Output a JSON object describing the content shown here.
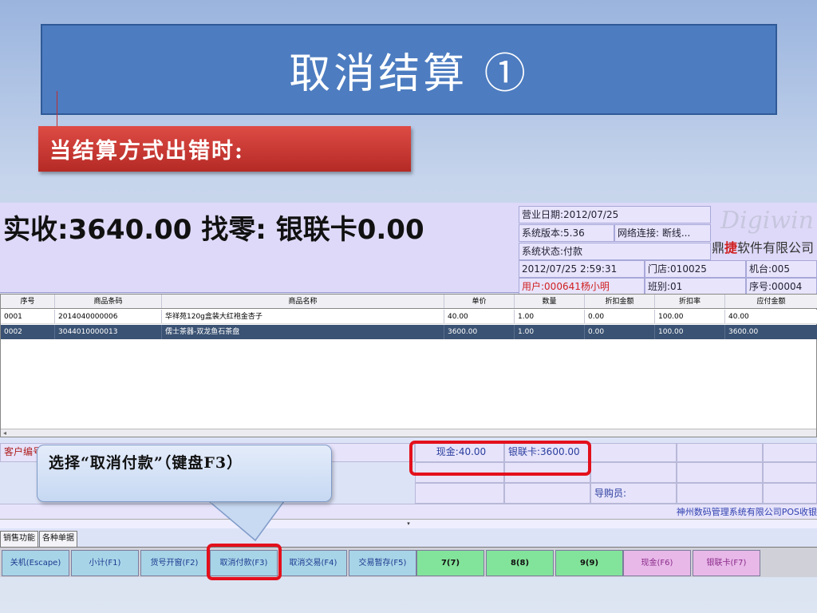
{
  "slide": {
    "title": "取消结算 ①",
    "subtitle": "当结算方式出错时:",
    "callout": "选择“取消付款”（键盘F3）"
  },
  "pos": {
    "amount_line": "实收:3640.00 找零: 银联卡0.00",
    "info": {
      "business_date": "营业日期:2012/07/25",
      "version": "系统版本:5.36",
      "network": "网络连接: 断线...",
      "status": "系统状态:付款",
      "datetime": "2012/07/25 2:59:31",
      "store": "门店:010025",
      "machine": "机台:005",
      "user": "用户:000641杨小明",
      "shift": "班别:01",
      "sequence": "序号:00004"
    },
    "logo": {
      "script": "Digiwin",
      "name_prefix": "鼎",
      "name_highlight": "捷",
      "name_suffix": "软件有限公司"
    },
    "columns": [
      "序号",
      "商品条码",
      "商品名称",
      "单价",
      "数量",
      "折扣金额",
      "折扣率",
      "应付金额"
    ],
    "rows": [
      [
        "0001",
        "2014040000006",
        "华祥苑120g盒装大红袍金杏子",
        "40.00",
        "1.00",
        "0.00",
        "100.00",
        "40.00"
      ],
      [
        "0002",
        "3044010000013",
        "儒士茶器-双龙鱼石茶盘",
        "3600.00",
        "1.00",
        "0.00",
        "100.00",
        "3600.00"
      ]
    ],
    "scroll_marker": "◂",
    "customer_label": "客户编号",
    "payments": {
      "cash": "现金:40.00",
      "unionpay": "银联卡:3600.00"
    },
    "salesperson_label": "导购员:",
    "company_text": "神州数码管理系统有限公司POS收银",
    "dropdown_arrow": "▾",
    "tabs": [
      "销售功能",
      "各种单据"
    ],
    "buttons": {
      "shutdown": "关机(Escape)",
      "subtotal": "小计(F1)",
      "item_window": "货号开窗(F2)",
      "cancel_payment": "取消付款(F3)",
      "cancel_transaction": "取消交易(F4)",
      "suspend_transaction": "交易暂存(F5)",
      "num7": "7(7)",
      "num8": "8(8)",
      "num9": "9(9)",
      "cash": "现金(F6)",
      "unionpay": "银联卡(F7)"
    }
  },
  "colors": {
    "title_bg": "#4d7cc0",
    "subtitle_bg": "#c8342f",
    "highlight": "#e3101c",
    "selected_row": "#3a5273"
  }
}
